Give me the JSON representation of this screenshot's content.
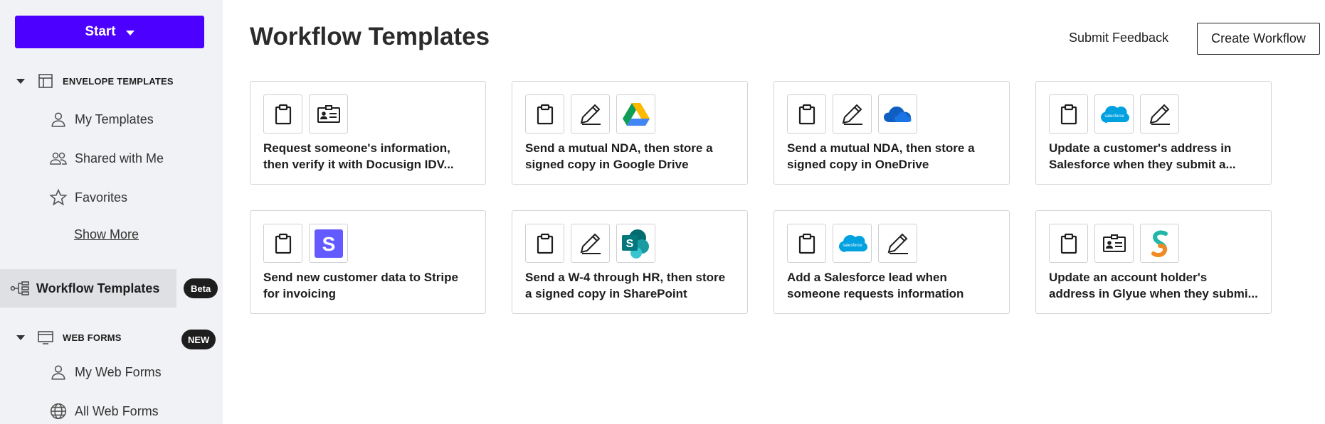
{
  "sidebar": {
    "start_label": "Start",
    "envelope_templates_label": "ENVELOPE TEMPLATES",
    "my_templates": "My Templates",
    "shared_with_me": "Shared with Me",
    "favorites": "Favorites",
    "show_more": "Show More",
    "workflow_templates": "Workflow Templates",
    "beta_badge": "Beta",
    "web_forms_label": "WEB FORMS",
    "new_badge": "NEW",
    "my_web_forms": "My Web Forms",
    "all_web_forms": "All Web Forms"
  },
  "header": {
    "title": "Workflow Templates",
    "submit_feedback": "Submit Feedback",
    "create_workflow": "Create Workflow"
  },
  "cards": [
    {
      "line1": "Request someone's information,",
      "line2": "then verify it with Docusign IDV...",
      "icons": [
        "clipboard-icon",
        "id-card-icon"
      ]
    },
    {
      "line1": "Send a mutual NDA, then store a",
      "line2": "signed copy in Google Drive",
      "icons": [
        "clipboard-icon",
        "pen-icon",
        "google-drive-icon"
      ]
    },
    {
      "line1": "Send a mutual NDA, then store a",
      "line2": "signed copy in OneDrive",
      "icons": [
        "clipboard-icon",
        "pen-icon",
        "onedrive-icon"
      ]
    },
    {
      "line1": "Update a customer's address in",
      "line2": "Salesforce when they submit a...",
      "icons": [
        "clipboard-icon",
        "salesforce-icon",
        "pen-icon"
      ]
    },
    {
      "line1": "Send new customer data to Stripe",
      "line2": "for invoicing",
      "icons": [
        "clipboard-icon",
        "stripe-icon"
      ]
    },
    {
      "line1": "Send a W-4 through HR, then store",
      "line2": "a signed copy in SharePoint",
      "icons": [
        "clipboard-icon",
        "pen-icon",
        "sharepoint-icon"
      ]
    },
    {
      "line1": "Add a Salesforce lead when",
      "line2": "someone requests information",
      "icons": [
        "clipboard-icon",
        "salesforce-icon",
        "pen-icon"
      ]
    },
    {
      "line1": "Update an account holder's",
      "line2": "address in Glyue when they submi...",
      "icons": [
        "clipboard-icon",
        "id-card-icon",
        "glyue-icon"
      ]
    }
  ],
  "brand_colors": {
    "primary": "#4c00ff",
    "salesforce": "#00a1e0",
    "stripe": "#635bff",
    "onedrive": "#0f5fc2",
    "sharepoint": "#038387",
    "glyue": "#f08a24"
  }
}
